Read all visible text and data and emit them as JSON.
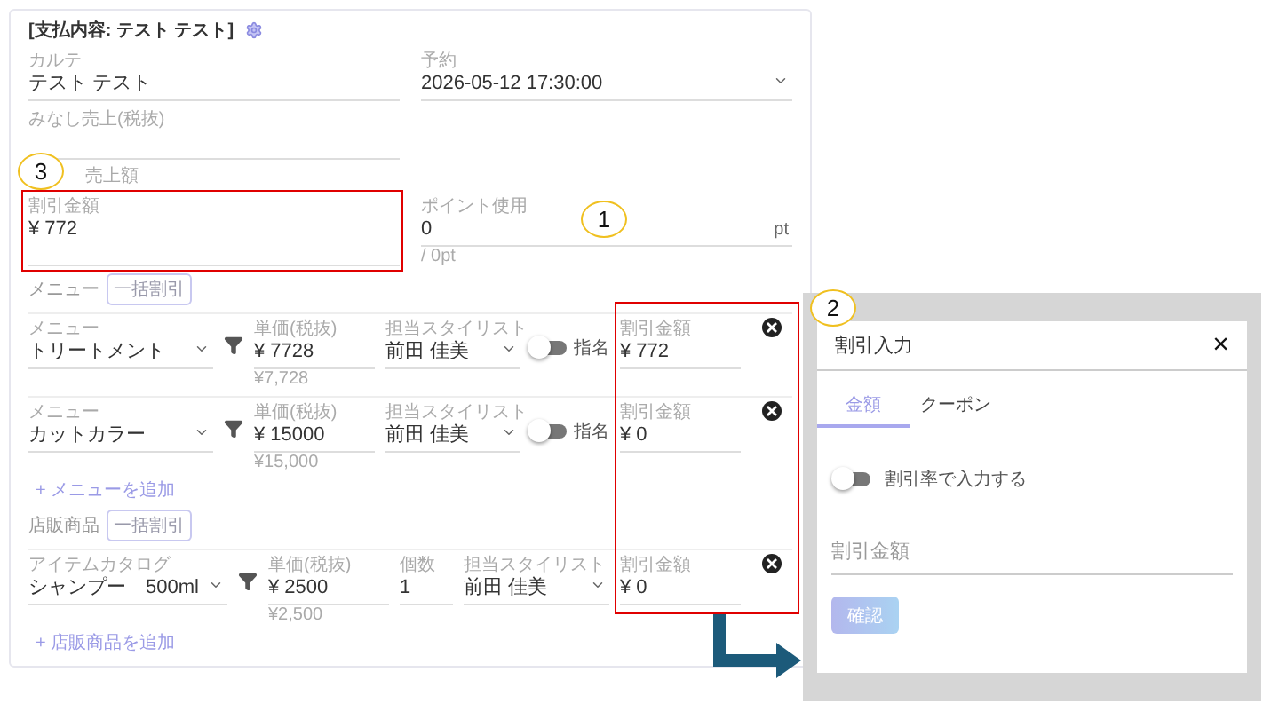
{
  "panel": {
    "title": "[支払内容: テスト テスト]",
    "top_fields": [
      {
        "label": "カルテ",
        "value": "テスト テスト",
        "kind": "text"
      },
      {
        "label": "予約",
        "value": "2026-05-12 17:30:00",
        "kind": "select"
      }
    ],
    "sales_field": {
      "label": "みなし売上(税抜)"
    },
    "sales_heading": "売上額",
    "discount_field": {
      "label": "割引金額",
      "value": "¥ 772"
    },
    "points_field": {
      "label": "ポイント使用",
      "value": "0",
      "unit": "pt",
      "hint": "/ 0pt"
    },
    "sections": [
      {
        "title": "メニュー",
        "bulk_button": "一括割引",
        "add_link": "+ メニューを追加",
        "rows": [
          {
            "kind": "menu",
            "item_label": "メニュー",
            "item": "トリートメント",
            "price_label": "単価(税抜)",
            "price": "¥ 7728",
            "price_hint": "¥7,728",
            "stylist_label": "担当スタイリスト",
            "stylist": "前田 佳美",
            "nominated_label": "指名",
            "nominated": false,
            "discount_label": "割引金額",
            "discount": "¥ 772"
          },
          {
            "kind": "menu",
            "item_label": "メニュー",
            "item": "カットカラー",
            "price_label": "単価(税抜)",
            "price": "¥ 15000",
            "price_hint": "¥15,000",
            "stylist_label": "担当スタイリスト",
            "stylist": "前田 佳美",
            "nominated_label": "指名",
            "nominated": false,
            "discount_label": "割引金額",
            "discount": "¥ 0"
          }
        ]
      },
      {
        "title": "店販商品",
        "bulk_button": "一括割引",
        "add_link": "+ 店販商品を追加",
        "rows": [
          {
            "kind": "product",
            "item_label": "アイテムカタログ",
            "item": "シャンプー　500ml",
            "price_label": "単価(税抜)",
            "price": "¥ 2500",
            "price_hint": "¥2,500",
            "qty_label": "個数",
            "qty": "1",
            "stylist_label": "担当スタイリスト",
            "stylist": "前田 佳美",
            "discount_label": "割引金額",
            "discount": "¥ 0"
          }
        ]
      }
    ]
  },
  "dialog": {
    "title": "割引入力",
    "close": "×",
    "tabs": [
      {
        "label": "金額",
        "selected": true
      },
      {
        "label": "クーポン",
        "selected": false
      }
    ],
    "rate_toggle": {
      "label": "割引率で入力する",
      "on": false
    },
    "amount_field": {
      "placeholder": "割引金額"
    },
    "confirm_button": {
      "label": "確認",
      "disabled": true
    }
  },
  "callouts": [
    {
      "number": "1"
    },
    {
      "number": "2"
    },
    {
      "number": "3"
    }
  ]
}
